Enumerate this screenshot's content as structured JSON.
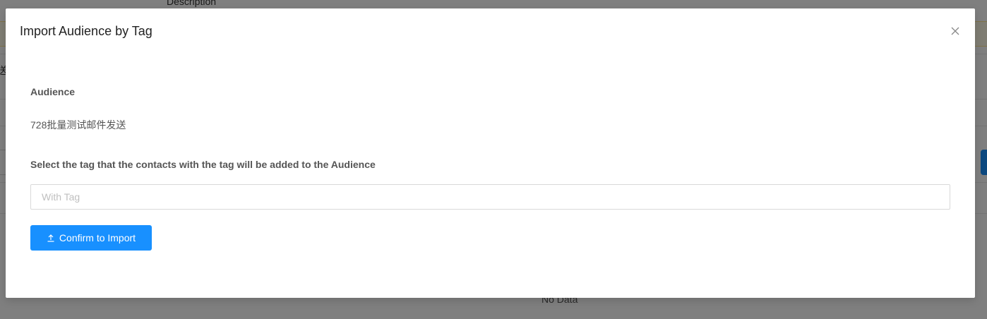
{
  "background": {
    "column_header": "Description",
    "truncated_cell": "送",
    "empty_text": "No Data"
  },
  "modal": {
    "title": "Import Audience by Tag",
    "close_icon": "close-icon",
    "audience_label": "Audience",
    "audience_value": "728批量测试邮件发送",
    "tag_label": "Select the tag that the contacts with the tag will be added to the Audience",
    "tag_input": {
      "value": "",
      "placeholder": "With Tag"
    },
    "confirm_button": {
      "label": "Confirm to Import",
      "icon": "upload-icon"
    }
  },
  "colors": {
    "primary": "#1890ff",
    "overlay": "rgba(0,0,0,0.5)",
    "label_text": "#555555"
  }
}
